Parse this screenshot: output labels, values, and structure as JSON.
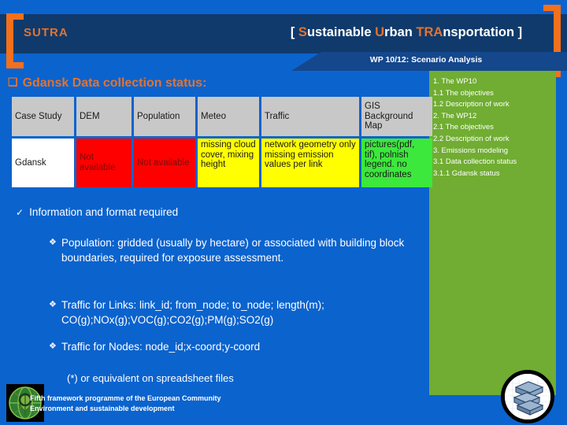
{
  "header": {
    "logo": "SUTRA",
    "title_parts": [
      {
        "text": "[ ",
        "hl": false
      },
      {
        "text": "S",
        "hl": true
      },
      {
        "text": "ustainable ",
        "hl": false
      },
      {
        "text": "U",
        "hl": true
      },
      {
        "text": "rban ",
        "hl": false
      },
      {
        "text": "TRA",
        "hl": true
      },
      {
        "text": "nsportation ]",
        "hl": false
      }
    ],
    "title_plain": "[ Sustainable Urban TRAnsportation ]",
    "subtitle": "WP 10/12: Scenario Analysis",
    "accent_color": "#E2732F",
    "band_color": "#103A6B"
  },
  "outline": {
    "background_color": "#70AD32",
    "items": [
      "1. The WP10",
      "1.1 The objectives",
      "1.2 Description of work",
      "2. The WP12",
      "2.1 The objectives",
      "2.2 Description of work",
      "3. Emissions modeling",
      "3.1 Data collection status",
      "3.1.1 Gdansk status"
    ]
  },
  "main": {
    "heading_bullet": "❑",
    "heading": "Gdansk Data collection status:",
    "table": {
      "headers": [
        "Case Study",
        "DEM",
        "Population",
        "Meteo",
        "Traffic",
        "GIS Background Map"
      ],
      "rows": [
        {
          "cells": [
            {
              "text": "Gdansk",
              "color": "#FFFFFF",
              "status": "none"
            },
            {
              "text": "Not available",
              "color": "#FF0000",
              "status": "missing"
            },
            {
              "text": "Not available",
              "color": "#FF0000",
              "status": "missing"
            },
            {
              "text": "missing cloud cover, mixing height",
              "color": "#FFFF00",
              "status": "partial"
            },
            {
              "text": "network geometry only missing emission values per link",
              "color": "#FFFF00",
              "status": "partial"
            },
            {
              "text": "pictures(pdf, tif), polnish legend. no coordinates",
              "color": "#3CE83C",
              "status": "available"
            }
          ]
        }
      ]
    },
    "bullets": {
      "level1_marker": "✓",
      "level1_text": "Information and format required",
      "level2_marker": "❖",
      "items": [
        "Population: gridded (usually by hectare) or associated with building block boundaries, required for exposure assessment.",
        "Traffic for Links: link_id; from_node; to_node; length(m); CO(g);NOx(g);VOC(g);CO2(g);PM(g);SO2(g)",
        "Traffic for Nodes: node_id;x-coord;y-coord"
      ],
      "note": "(*) or equivalent on spreadsheet files"
    }
  },
  "footer": {
    "line1": "Fifth framework programme of the European Community",
    "line2": "Environment and sustainable development"
  }
}
